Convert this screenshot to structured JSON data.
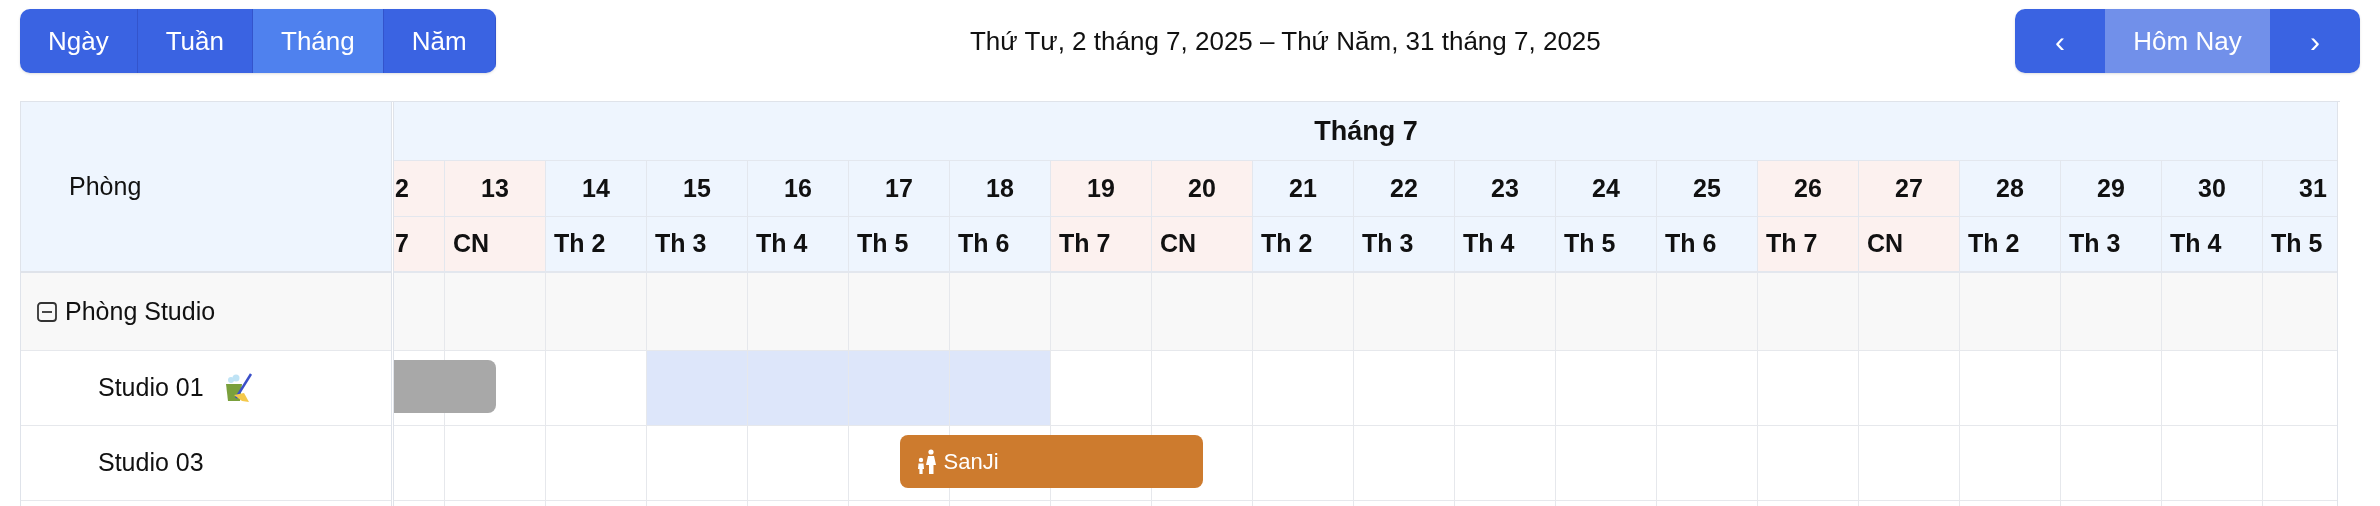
{
  "view_tabs": [
    {
      "label": "Ngày",
      "selected": false
    },
    {
      "label": "Tuần",
      "selected": false
    },
    {
      "label": "Tháng",
      "selected": true
    },
    {
      "label": "Năm",
      "selected": false
    }
  ],
  "date_range": "Thứ Tư, 2 tháng 7, 2025 – Thứ Năm, 31 tháng 7, 2025",
  "nav": {
    "prev": "‹",
    "today": "Hôm Nay",
    "next": "›"
  },
  "calendar": {
    "room_header": "Phòng",
    "month_label": "Tháng 7",
    "days": [
      {
        "day": "2",
        "weekday": "7",
        "weekend": true
      },
      {
        "day": "13",
        "weekday": "CN",
        "weekend": true
      },
      {
        "day": "14",
        "weekday": "Th 2",
        "weekend": false
      },
      {
        "day": "15",
        "weekday": "Th 3",
        "weekend": false
      },
      {
        "day": "16",
        "weekday": "Th 4",
        "weekend": false
      },
      {
        "day": "17",
        "weekday": "Th 5",
        "weekend": false
      },
      {
        "day": "18",
        "weekday": "Th 6",
        "weekend": false
      },
      {
        "day": "19",
        "weekday": "Th 7",
        "weekend": true
      },
      {
        "day": "20",
        "weekday": "CN",
        "weekend": true
      },
      {
        "day": "21",
        "weekday": "Th 2",
        "weekend": false
      },
      {
        "day": "22",
        "weekday": "Th 3",
        "weekend": false
      },
      {
        "day": "23",
        "weekday": "Th 4",
        "weekend": false
      },
      {
        "day": "24",
        "weekday": "Th 5",
        "weekend": false
      },
      {
        "day": "25",
        "weekday": "Th 6",
        "weekend": false
      },
      {
        "day": "26",
        "weekday": "Th 7",
        "weekend": true
      },
      {
        "day": "27",
        "weekday": "CN",
        "weekend": true
      },
      {
        "day": "28",
        "weekday": "Th 2",
        "weekend": false
      },
      {
        "day": "29",
        "weekday": "Th 3",
        "weekend": false
      },
      {
        "day": "30",
        "weekday": "Th 4",
        "weekend": false
      },
      {
        "day": "31",
        "weekday": "Th 5",
        "weekend": false
      }
    ],
    "groups": [
      {
        "name": "Phòng Studio",
        "expanded": true,
        "rooms": [
          {
            "name": "Studio 01",
            "needs_cleaning": true,
            "event": {
              "kind": "blocked"
            },
            "cells": [
              {
                "selected": false,
                "occupied": true
              },
              {
                "selected": false,
                "checkout": true
              },
              {
                "selected": false
              },
              {
                "selected": true
              },
              {
                "selected": true
              },
              {
                "selected": true
              },
              {
                "selected": true
              },
              {
                "selected": false
              },
              {
                "selected": false
              },
              {
                "selected": false
              },
              {
                "selected": false
              },
              {
                "selected": false
              },
              {
                "selected": false
              },
              {
                "selected": false
              },
              {
                "selected": false
              },
              {
                "selected": false
              },
              {
                "selected": false
              },
              {
                "selected": false
              },
              {
                "selected": false
              },
              {
                "selected": false
              }
            ]
          },
          {
            "name": "Studio 03",
            "needs_cleaning": false,
            "event": {
              "kind": "booking",
              "guest": "SanJi"
            },
            "cells": [
              {
                "selected": false
              },
              {
                "selected": false
              },
              {
                "selected": false
              },
              {
                "selected": false
              },
              {
                "selected": false
              },
              {
                "selected": false,
                "checkin": true
              },
              {
                "selected": false
              },
              {
                "selected": false
              },
              {
                "selected": false,
                "checkout": true
              },
              {
                "selected": false
              },
              {
                "selected": false
              },
              {
                "selected": false
              },
              {
                "selected": false
              },
              {
                "selected": false
              },
              {
                "selected": false
              },
              {
                "selected": false
              },
              {
                "selected": false
              },
              {
                "selected": false
              },
              {
                "selected": false
              },
              {
                "selected": false
              }
            ]
          }
        ]
      }
    ]
  }
}
